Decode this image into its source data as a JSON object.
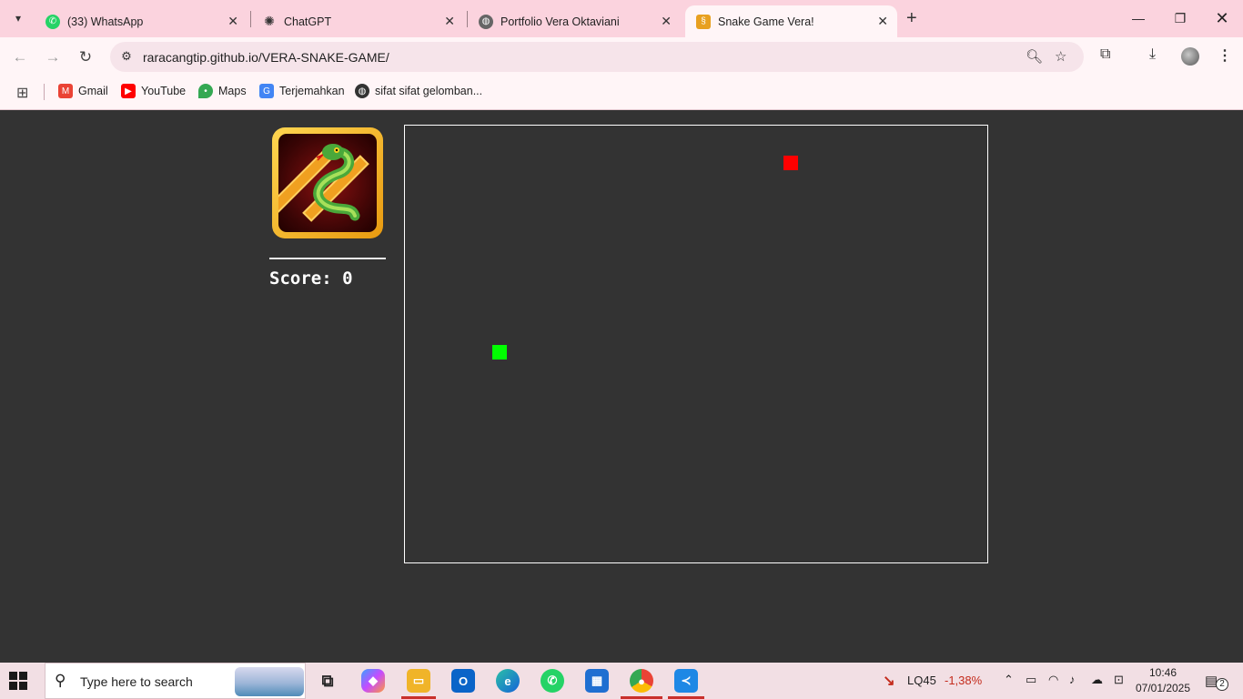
{
  "browser": {
    "tabs": [
      {
        "title": "(33) WhatsApp",
        "icon": "whatsapp-icon",
        "active": false
      },
      {
        "title": "ChatGPT",
        "icon": "chatgpt-icon",
        "active": false
      },
      {
        "title": "Portfolio Vera Oktaviani",
        "icon": "globe-icon",
        "active": false
      },
      {
        "title": "Snake Game Vera!",
        "icon": "snake-game-icon",
        "active": true
      }
    ],
    "url": "raracangtip.github.io/VERA-SNAKE-GAME/",
    "bookmarks": [
      {
        "label": "Gmail",
        "icon": "gmail-icon"
      },
      {
        "label": "YouTube",
        "icon": "youtube-icon"
      },
      {
        "label": "Maps",
        "icon": "maps-icon"
      },
      {
        "label": "Terjemahkan",
        "icon": "translate-icon"
      },
      {
        "label": "sifat sifat gelomban...",
        "icon": "globe-icon"
      }
    ]
  },
  "game": {
    "score_label": "Score: 0",
    "score": 0,
    "colors": {
      "food": "#ff0000",
      "snake": "#00ff00",
      "background": "#333333",
      "border": "#ffffff"
    }
  },
  "taskbar": {
    "search_placeholder": "Type here to search",
    "stock_name": "LQ45",
    "stock_change": "-1,38%",
    "time": "10:46",
    "date": "07/01/2025",
    "notification_count": "2"
  }
}
